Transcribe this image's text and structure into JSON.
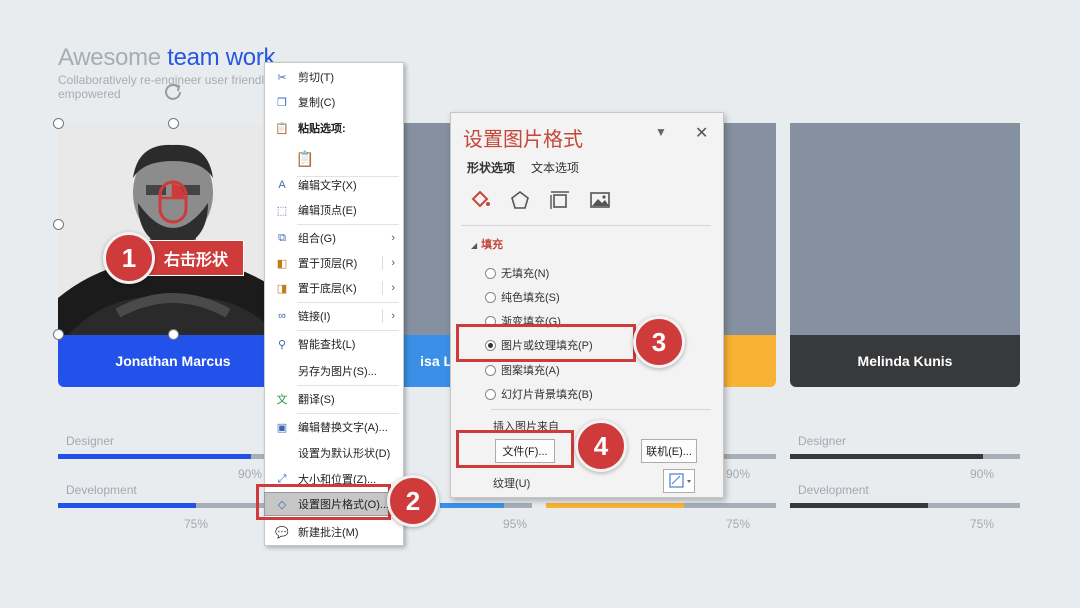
{
  "slide": {
    "title_plain": "Awesome ",
    "title_accent": "team work",
    "subtitle": "Collaboratively re-engineer user friendly empowered"
  },
  "cards": [
    {
      "name": "Jonathan Marcus",
      "color": "#2352ea"
    },
    {
      "name": "isa Lore",
      "color": "#3b8fe6"
    },
    {
      "name": "",
      "color": "#f9b233"
    },
    {
      "name": "Melinda Kunis",
      "color": "#38393b"
    }
  ],
  "skills": {
    "designer_label": "Designer",
    "development_label": "Development",
    "columns": [
      {
        "designer_pct": "90%",
        "designer_fraction": 0.9,
        "development_pct": "75%",
        "development_fraction": 0.6
      },
      {
        "designer_pct": "",
        "designer_fraction": 0.9,
        "development_pct": "95%",
        "development_fraction": 0.95
      },
      {
        "designer_pct": "90%",
        "designer_fraction": 0.9,
        "development_pct": "75%",
        "development_fraction": 0.6
      },
      {
        "designer_pct": "90%",
        "designer_fraction": 0.9,
        "development_pct": "75%",
        "development_fraction": 0.6
      }
    ]
  },
  "callouts": {
    "step1": "1",
    "step1_label": "右击形状",
    "step2": "2",
    "step3": "3",
    "step4": "4",
    "color": "#cf3b3b"
  },
  "context_menu": {
    "cut": "剪切(T)",
    "copy": "复制(C)",
    "paste_options": "粘贴选项:",
    "edit_text": "编辑文字(X)",
    "edit_points": "编辑顶点(E)",
    "group": "组合(G)",
    "bring_front": "置于顶层(R)",
    "send_back": "置于底层(K)",
    "link": "链接(I)",
    "smart_lookup": "智能查找(L)",
    "save_as_picture": "另存为图片(S)...",
    "translate": "翻译(S)",
    "edit_alt_text": "编辑替换文字(A)...",
    "set_default_shape": "设置为默认形状(D)",
    "size_position": "大小和位置(Z)...",
    "format_picture": "设置图片格式(O)...",
    "new_comment": "新建批注(M)"
  },
  "format_panel": {
    "title": "设置图片格式",
    "dropdown_icon": "▼",
    "close_icon": "✕",
    "tab_shape": "形状选项",
    "tab_text": "文本选项",
    "section_fill": "填充",
    "fill_options": [
      {
        "label": "无填充(N)",
        "selected": false
      },
      {
        "label": "纯色填充(S)",
        "selected": false
      },
      {
        "label": "渐变填充(G)",
        "selected": false
      },
      {
        "label": "图片或纹理填充(P)",
        "selected": true
      },
      {
        "label": "图案填充(A)",
        "selected": false
      },
      {
        "label": "幻灯片背景填充(B)",
        "selected": false
      }
    ],
    "insert_from": "插入图片来自",
    "file_button": "文件(F)...",
    "online_button": "联机(E)...",
    "texture_label": "纹理(U)"
  }
}
